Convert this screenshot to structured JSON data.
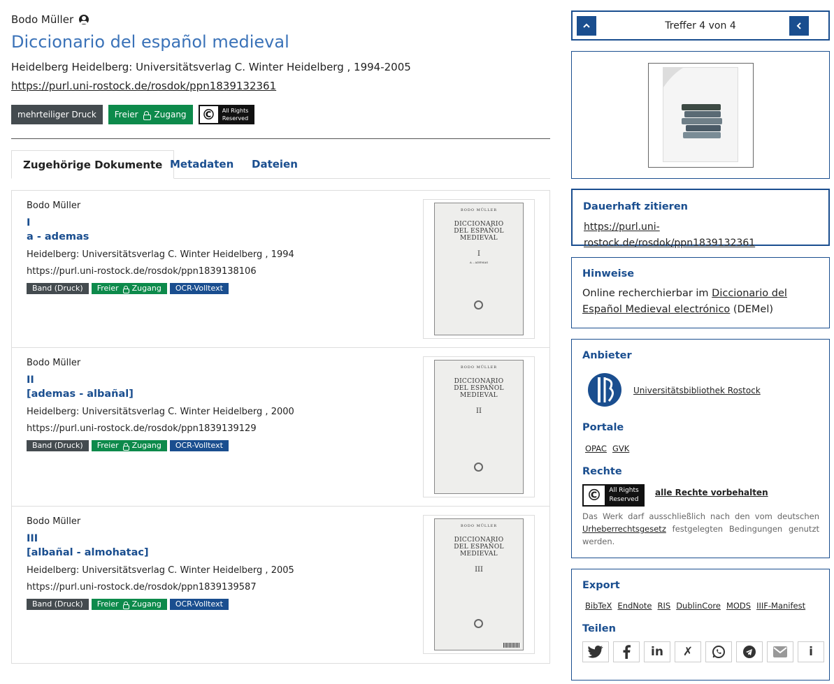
{
  "record": {
    "author": "Bodo Müller",
    "title": "Diccionario del español medieval",
    "publication": "Heidelberg Heidelberg: Universitätsverlag C. Winter Heidelberg , 1994-2005",
    "purl": "https://purl.uni-rostock.de/rosdok/ppn1839132361",
    "badges": {
      "type": "mehrteiliger Druck",
      "access_pre": "Freier",
      "access_post": "Zugang",
      "rights_line1": "All Rights",
      "rights_line2": "Reserved"
    }
  },
  "tabs": [
    "Zugehörige Dokumente",
    "Metadaten",
    "Dateien"
  ],
  "documents": [
    {
      "author": "Bodo Müller",
      "volume": "I",
      "range": "a - ademas",
      "publication": "Heidelberg: Universitätsverlag C. Winter Heidelberg , 1994",
      "url": "https://purl.uni-rostock.de/rosdok/ppn1839138106",
      "badge_type": "Band (Druck)",
      "badge_access_pre": "Freier",
      "badge_access_post": "Zugang",
      "badge_ocr": "OCR-Volltext",
      "cover": {
        "author": "BODO MÜLLER",
        "title1": "DICCIONARIO",
        "title2": "DEL ESPAÑOL MEDIEVAL",
        "vol": "I",
        "sub": "A – ADEMAS"
      }
    },
    {
      "author": "Bodo Müller",
      "volume": "II",
      "range": "[ademas - albañal]",
      "publication": "Heidelberg: Universitätsverlag C. Winter Heidelberg , 2000",
      "url": "https://purl.uni-rostock.de/rosdok/ppn1839139129",
      "badge_type": "Band (Druck)",
      "badge_access_pre": "Freier",
      "badge_access_post": "Zugang",
      "badge_ocr": "OCR-Volltext",
      "cover": {
        "author": "BODO MÜLLER",
        "title1": "DICCIONARIO",
        "title2": "DEL ESPAÑOL MEDIEVAL",
        "vol": "II",
        "sub": ""
      }
    },
    {
      "author": "Bodo Müller",
      "volume": "III",
      "range": "[albañal - almohatac]",
      "publication": "Heidelberg: Universitätsverlag C. Winter Heidelberg , 2005",
      "url": "https://purl.uni-rostock.de/rosdok/ppn1839139587",
      "badge_type": "Band (Druck)",
      "badge_access_pre": "Freier",
      "badge_access_post": "Zugang",
      "badge_ocr": "OCR-Volltext",
      "cover": {
        "author": "BODO MÜLLER",
        "title1": "DICCIONARIO",
        "title2": "DEL ESPAÑOL MEDIEVAL",
        "vol": "III",
        "sub": ""
      }
    }
  ],
  "sidebar": {
    "nav": {
      "count": "Treffer 4 von 4",
      "up_icon": "chevron-up-icon",
      "back_icon": "chevron-left-icon"
    },
    "cite": {
      "heading": "Dauerhaft zitieren",
      "url": "https://purl.uni-rostock.de/rosdok/ppn1839132361"
    },
    "hints": {
      "heading": "Hinweise",
      "text_pre": "Online recherchierbar im",
      "link": "Diccionario del Español Medieval electrónico",
      "text_post": "(DEMel)"
    },
    "provider": {
      "heading": "Anbieter",
      "name": "Universitätsbibliothek Rostock"
    },
    "portals": {
      "heading": "Portale",
      "links": [
        "OPAC",
        "GVK"
      ]
    },
    "rights": {
      "heading": "Rechte",
      "logo_line1": "All Rights",
      "logo_line2": "Reserved",
      "link": "alle Rechte vorbehalten",
      "text_pre": "Das Werk darf ausschließlich nach den vom deutschen",
      "text_link": "Urheberrechtsgesetz",
      "text_post": "festgelegten Bedingungen genutzt werden."
    },
    "export": {
      "heading": "Export",
      "links": [
        "BibTeX",
        "EndNote",
        "RIS",
        "DublinCore",
        "MODS",
        "IIIF-Manifest"
      ]
    },
    "share": {
      "heading": "Teilen",
      "icons": [
        "twitter-icon",
        "facebook-icon",
        "linkedin-icon",
        "xing-icon",
        "whatsapp-icon",
        "telegram-icon",
        "email-icon",
        "info-icon"
      ]
    }
  },
  "colors": {
    "accent": "#1a4e8f",
    "title": "#3a72b8",
    "green": "#0d8a4b",
    "dark": "#444b4f"
  }
}
